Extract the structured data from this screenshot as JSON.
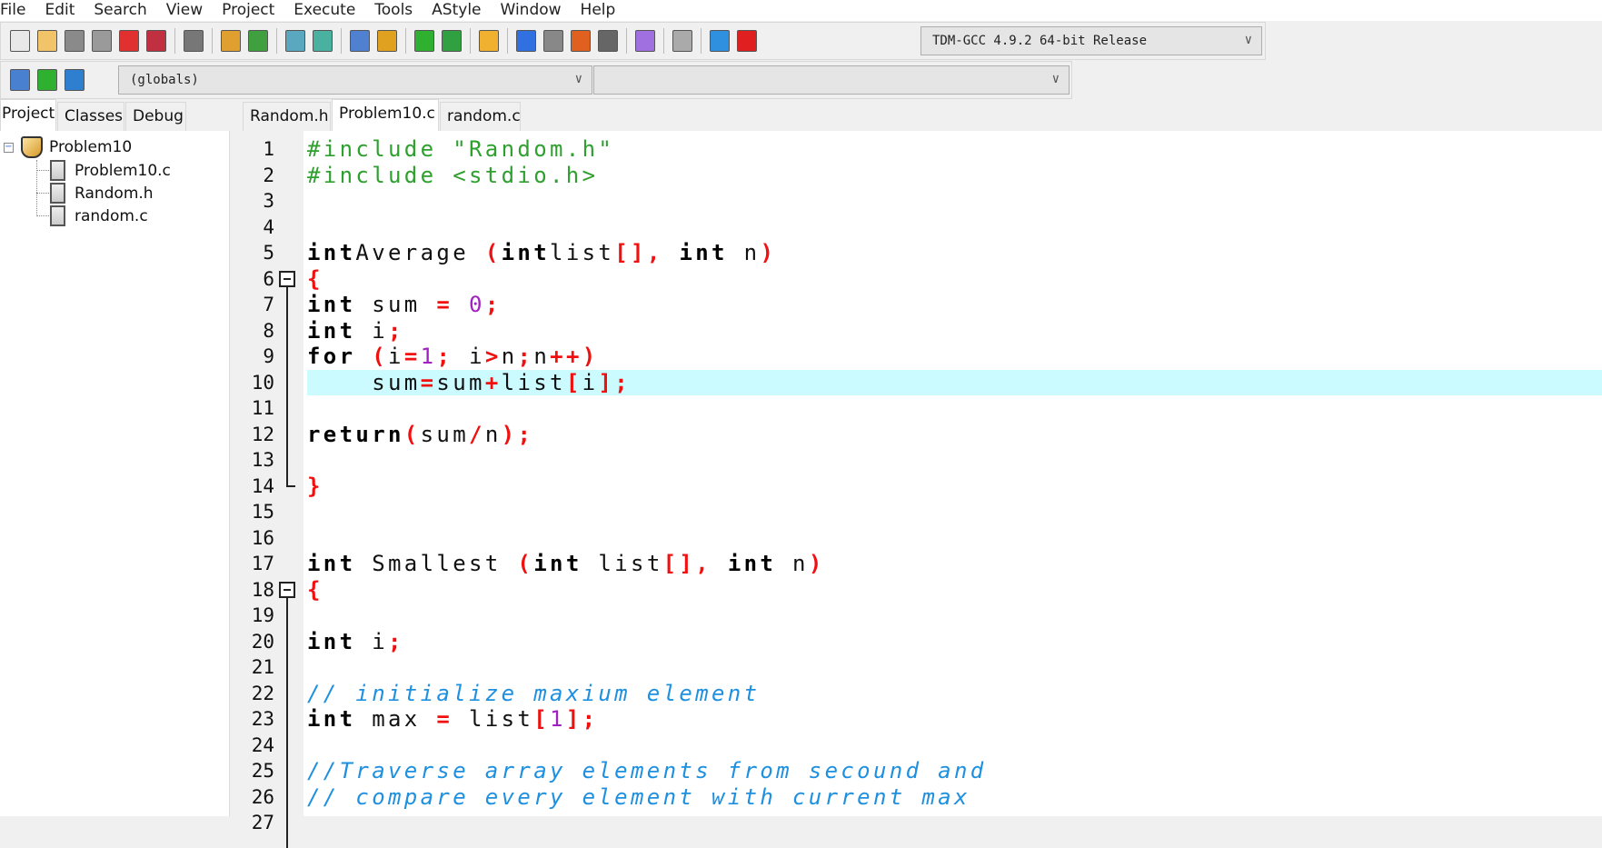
{
  "menu": [
    "File",
    "Edit",
    "Search",
    "View",
    "Project",
    "Execute",
    "Tools",
    "AStyle",
    "Window",
    "Help"
  ],
  "toolbar": {
    "icons": [
      "new-file-icon",
      "open-file-icon",
      "save-icon",
      "save-all-icon",
      "close-icon",
      "close-all-icon",
      "print-icon",
      "undo-icon",
      "redo-icon",
      "find-icon",
      "replace-icon",
      "indent-icon",
      "unindent-icon",
      "add-to-project-icon",
      "remove-from-project-icon",
      "class-browser-icon",
      "compile-icon",
      "run-icon",
      "compile-run-icon",
      "rebuild-icon",
      "syntax-check-icon",
      "stop-icon",
      "profile-icon",
      "delete-profile-icon"
    ],
    "compiler": "TDM-GCC 4.9.2 64-bit Release",
    "globals": "(globals)",
    "members": ""
  },
  "left_tabs": [
    "Project",
    "Classes",
    "Debug"
  ],
  "project": {
    "name": "Problem10",
    "files": [
      "Problem10.c",
      "Random.h",
      "random.c"
    ]
  },
  "editor_tabs": [
    "Random.h",
    "Problem10.c",
    "random.c"
  ],
  "active_tab": "Problem10.c",
  "highlight_color": "#ccfbff",
  "current_line": 10,
  "code": [
    [
      [
        "pp",
        "#include \"Random.h\""
      ]
    ],
    [
      [
        "pp",
        "#include <stdio.h>"
      ]
    ],
    [],
    [],
    [
      [
        "kw",
        "int"
      ],
      [
        "",
        "Average "
      ],
      [
        "sy",
        "("
      ],
      [
        "kw",
        "int"
      ],
      [
        "",
        "list"
      ],
      [
        "sy",
        "[],"
      ],
      [
        "",
        ""
      ],
      [
        "kw",
        " int"
      ],
      [
        "",
        " n"
      ],
      [
        "sy",
        ")"
      ]
    ],
    [
      [
        "sy",
        "{"
      ]
    ],
    [
      [
        "kw",
        "int"
      ],
      [
        "",
        " sum "
      ],
      [
        "sy",
        "="
      ],
      [
        "",
        ""
      ],
      [
        "nu",
        " 0"
      ],
      [
        "sy",
        ";"
      ]
    ],
    [
      [
        "kw",
        "int"
      ],
      [
        "",
        " i"
      ],
      [
        "sy",
        ";"
      ]
    ],
    [
      [
        "kw",
        "for"
      ],
      [
        "",
        " "
      ],
      [
        "sy",
        "("
      ],
      [
        "",
        "i"
      ],
      [
        "sy",
        "="
      ],
      [
        "nu",
        "1"
      ],
      [
        "sy",
        ";"
      ],
      [
        "",
        " i"
      ],
      [
        "sy",
        ">"
      ],
      [
        "",
        "n"
      ],
      [
        "sy",
        ";"
      ],
      [
        "",
        "n"
      ],
      [
        "sy",
        "++)"
      ]
    ],
    [
      [
        "",
        "    sum"
      ],
      [
        "sy",
        "="
      ],
      [
        "",
        "sum"
      ],
      [
        "sy",
        "+"
      ],
      [
        "",
        "list"
      ],
      [
        "sy",
        "["
      ],
      [
        "",
        "i"
      ],
      [
        "sy",
        "];"
      ]
    ],
    [],
    [
      [
        "kw",
        "return"
      ],
      [
        "sy",
        "("
      ],
      [
        "",
        "sum"
      ],
      [
        "sy",
        "/"
      ],
      [
        "",
        "n"
      ],
      [
        "sy",
        ");"
      ]
    ],
    [],
    [
      [
        "sy",
        "}"
      ]
    ],
    [],
    [],
    [
      [
        "kw",
        "int"
      ],
      [
        "",
        " Smallest "
      ],
      [
        "sy",
        "("
      ],
      [
        "kw",
        "int"
      ],
      [
        "",
        " list"
      ],
      [
        "sy",
        "[],"
      ],
      [
        "kw",
        " int"
      ],
      [
        "",
        " n"
      ],
      [
        "sy",
        ")"
      ]
    ],
    [
      [
        "sy",
        "{"
      ]
    ],
    [],
    [
      [
        "kw",
        "int"
      ],
      [
        "",
        " i"
      ],
      [
        "sy",
        ";"
      ]
    ],
    [],
    [
      [
        "cm",
        "// initialize maxium element"
      ]
    ],
    [
      [
        "kw",
        "int"
      ],
      [
        "",
        " max "
      ],
      [
        "sy",
        "="
      ],
      [
        "",
        " list"
      ],
      [
        "sy",
        "["
      ],
      [
        "nu",
        "1"
      ],
      [
        "sy",
        "];"
      ]
    ],
    [],
    [
      [
        "cm",
        "//Traverse array elements from secound and"
      ]
    ],
    [
      [
        "cm",
        "// compare every element with current max"
      ]
    ],
    []
  ]
}
